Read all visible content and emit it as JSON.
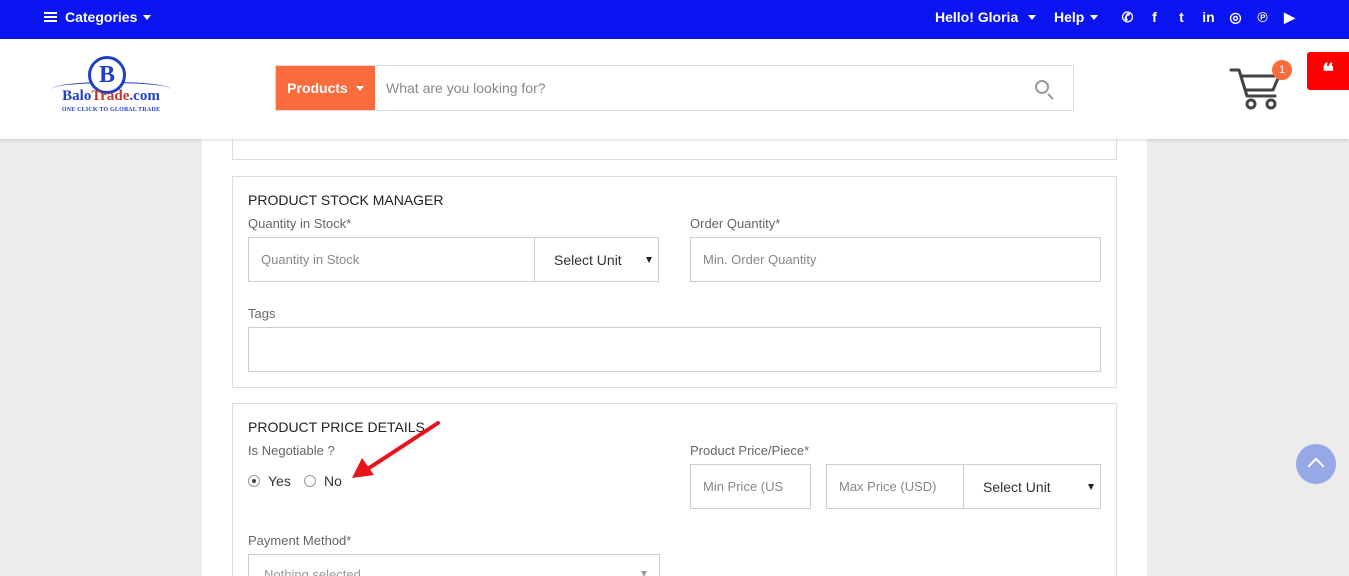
{
  "topbar": {
    "categories_label": "Categories",
    "greeting": "Hello! Gloria",
    "help_label": "Help",
    "social_icons": [
      "whatsapp-icon",
      "facebook-icon",
      "twitter-icon",
      "linkedin-icon",
      "instagram-icon",
      "pinterest-icon",
      "youtube-icon"
    ],
    "social_glyphs": [
      "✆",
      "f",
      "t",
      "in",
      "◎",
      "℗",
      "▶"
    ],
    "bg_color": "#0a14f0"
  },
  "header": {
    "logo": {
      "letter": "B",
      "name_part1": "Balo",
      "name_part2": "Trade",
      "name_part3": ".com",
      "tagline": "ONE CLICK TO GLOBAL TRADE"
    },
    "search": {
      "category_label": "Products",
      "placeholder": "What are you looking for?"
    },
    "cart_count": "1",
    "quote_glyph": "❝",
    "accent_color": "#fb6c3d"
  },
  "stock_manager": {
    "title": "PRODUCT STOCK MANAGER",
    "quantity_label": "Quantity in Stock*",
    "quantity_placeholder": "Quantity in Stock",
    "unit_select": "Select Unit",
    "order_label": "Order Quantity*",
    "order_placeholder": "Min. Order Quantity",
    "tags_label": "Tags"
  },
  "price_details": {
    "title": "PRODUCT PRICE DETAILS",
    "negotiable_label": "Is Negotiable ?",
    "yes_label": "Yes",
    "no_label": "No",
    "selected": "Yes",
    "price_label": "Product Price/Piece*",
    "min_placeholder": "Min Price (US",
    "max_placeholder": "Max Price (USD)",
    "unit_select": "Select Unit",
    "payment_label": "Payment Method*",
    "payment_placeholder": "Nothing selected"
  },
  "annotation_arrow_color": "#e8131b"
}
